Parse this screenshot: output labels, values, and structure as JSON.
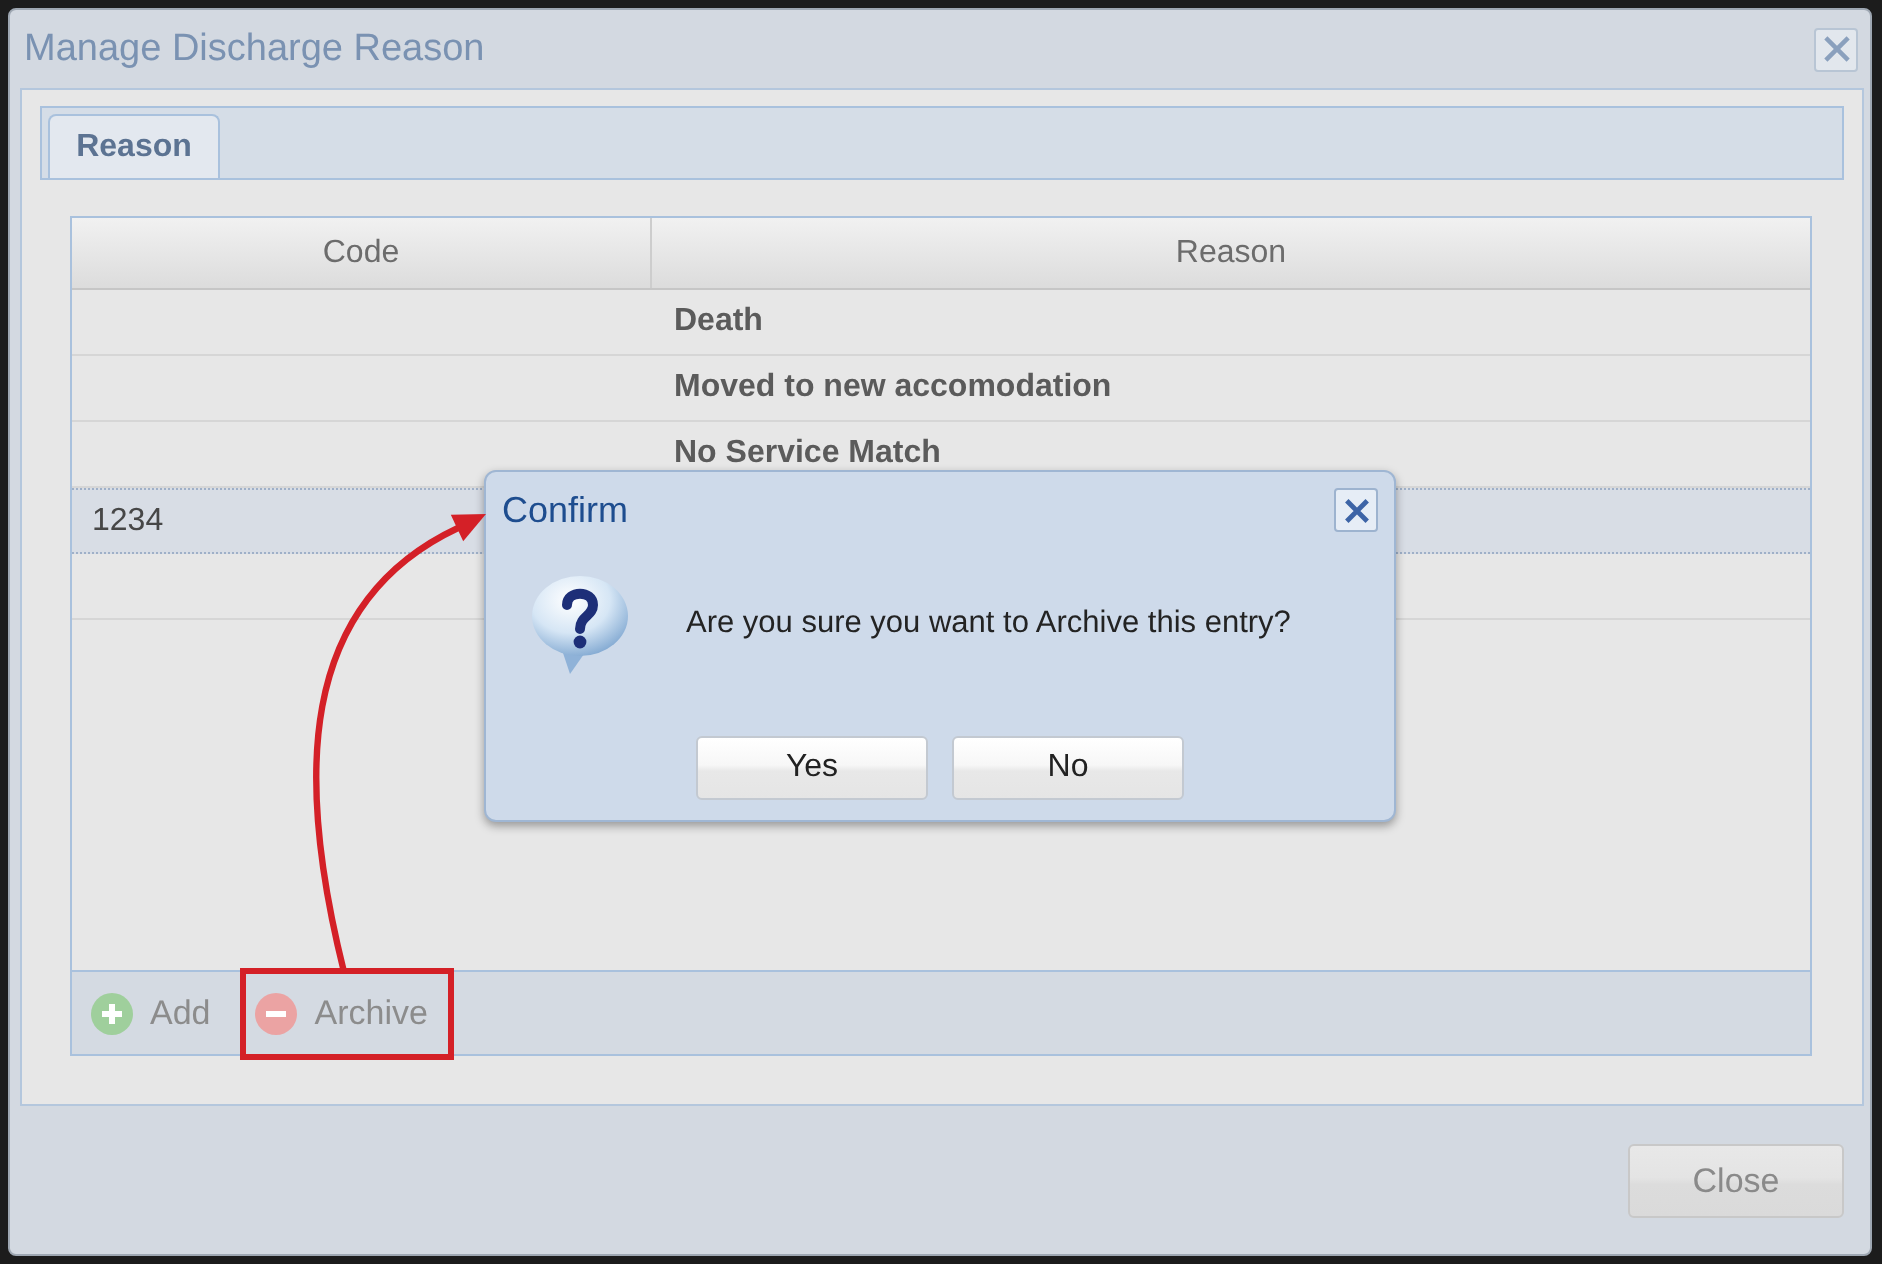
{
  "window": {
    "title": "Manage Discharge Reason"
  },
  "tabs": [
    {
      "label": "Reason",
      "selected": true
    }
  ],
  "table": {
    "columns": [
      "Code",
      "Reason"
    ],
    "rows": [
      {
        "reason": "Death",
        "selected": false
      },
      {
        "reason": "Moved to new accomodation",
        "selected": false
      },
      {
        "reason": "No Service Match",
        "selected": false
      },
      {
        "code": "1234",
        "selected": true
      },
      {
        "selected": false
      }
    ]
  },
  "toolbar": [
    {
      "kind": "add",
      "label": "Add",
      "disabled": true,
      "highlighted": false
    },
    {
      "kind": "archive",
      "label": "Archive",
      "disabled": true,
      "highlighted": true
    }
  ],
  "dialog": {
    "title": "Confirm",
    "message": "Are you sure you want to Archive this entry?",
    "buttons": [
      "Yes",
      "No"
    ]
  },
  "footer_buttons": [
    {
      "label": "Close",
      "disabled": true
    }
  ]
}
